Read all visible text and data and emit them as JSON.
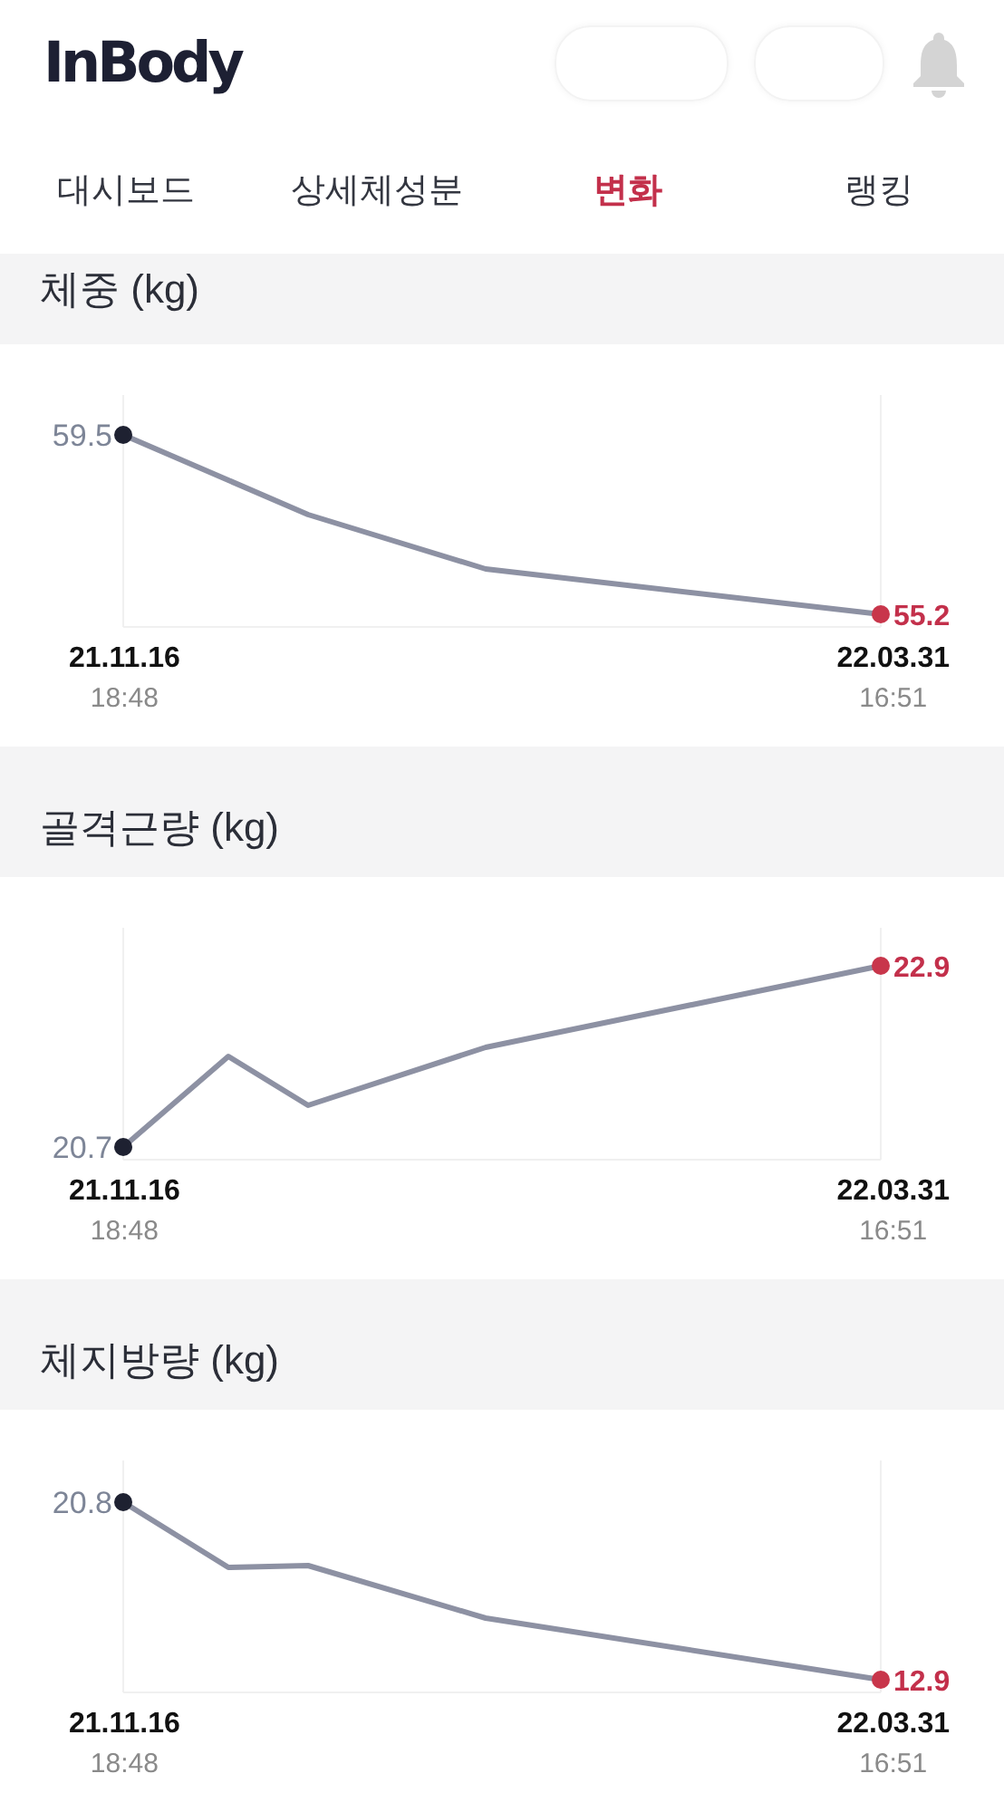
{
  "header": {
    "logo": "InBody"
  },
  "tabs": [
    {
      "label": "대시보드",
      "selected": false
    },
    {
      "label": "상세체성분",
      "selected": false
    },
    {
      "label": "변화",
      "selected": true
    },
    {
      "label": "랭킹",
      "selected": false
    }
  ],
  "sections": [
    {
      "title": "체중 (kg)",
      "start": {
        "value": "59.5",
        "date": "21.11.16",
        "time": "18:48"
      },
      "end": {
        "value": "55.2",
        "date": "22.03.31",
        "time": "16:51"
      }
    },
    {
      "title": "골격근량 (kg)",
      "start": {
        "value": "20.7",
        "date": "21.11.16",
        "time": "18:48"
      },
      "end": {
        "value": "22.9",
        "date": "22.03.31",
        "time": "16:51"
      }
    },
    {
      "title": "체지방량 (kg)",
      "start": {
        "value": "20.8",
        "date": "21.11.16",
        "time": "18:48"
      },
      "end": {
        "value": "12.9",
        "date": "22.03.31",
        "time": "16:51"
      }
    }
  ]
}
